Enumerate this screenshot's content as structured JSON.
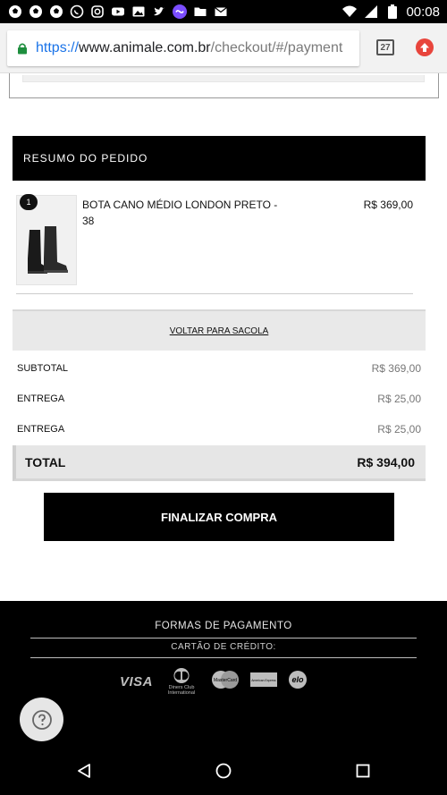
{
  "status_bar": {
    "time": "00:08",
    "icons": [
      "soccer-ball-icon",
      "soccer-ball-icon",
      "soccer-ball-icon",
      "whatsapp-icon",
      "instagram-icon",
      "youtube-icon",
      "image-icon",
      "twitter-icon",
      "messenger-icon",
      "folder-icon",
      "mail-icon",
      "wifi-icon",
      "signal-icon",
      "battery-icon"
    ]
  },
  "browser": {
    "url_scheme": "https://",
    "url_host": "www.animale.com.br",
    "url_path": "/checkout/#/payment",
    "tab_count": "27"
  },
  "order_summary": {
    "header": "RESUMO DO PEDIDO",
    "item": {
      "quantity": "1",
      "name": "BOTA CANO MÉDIO LONDON PRETO - 38",
      "price": "R$ 369,00"
    },
    "back_link": "VOLTAR PARA SACOLA",
    "lines": [
      {
        "label": "SUBTOTAL",
        "value": "R$ 369,00"
      },
      {
        "label": "ENTREGA",
        "value": "R$ 25,00"
      },
      {
        "label": "ENTREGA",
        "value": "R$ 25,00"
      }
    ],
    "total_label": "TOTAL",
    "total_value": "R$ 394,00"
  },
  "checkout_button": "FINALIZAR COMPRA",
  "footer": {
    "payment_title": "FORMAS DE PAGAMENTO",
    "card_title": "CARTÃO DE CRÉDITO:",
    "card_logos": [
      "VISA",
      "Diners Club International",
      "MasterCard",
      "American Express",
      "elo"
    ]
  },
  "colors": {
    "primary": "#000000",
    "background": "#ffffff",
    "muted_bar": "#e9e9e9",
    "update_badge": "#e8453c"
  }
}
